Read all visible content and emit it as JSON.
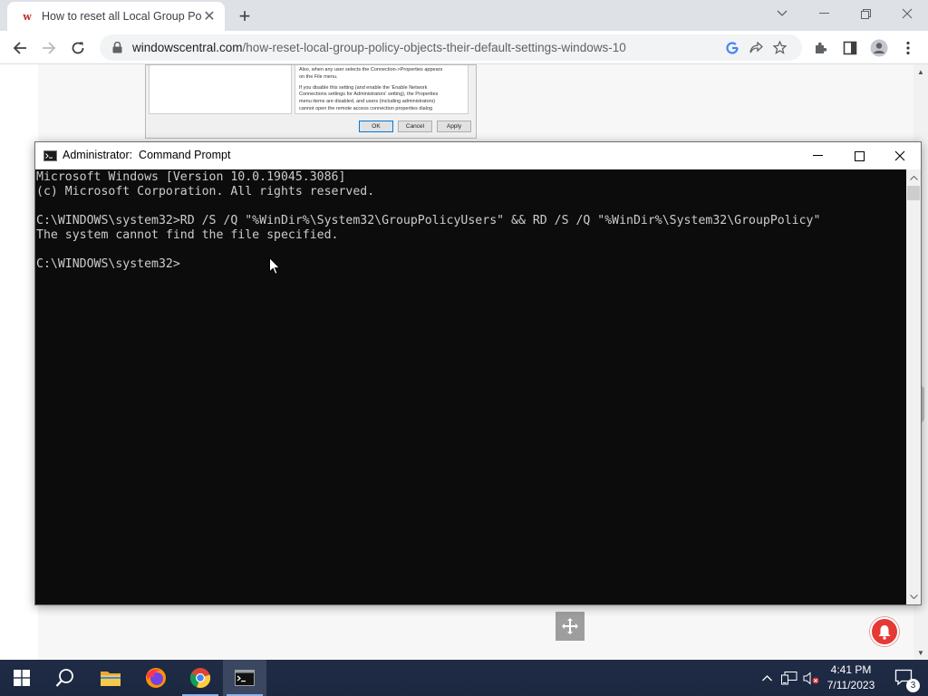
{
  "browser": {
    "tab": {
      "title": "How to reset all Local Group Poli",
      "favicon": "windows-central-favicon"
    },
    "url": {
      "domain": "windowscentral.com",
      "path": "/how-reset-local-group-policy-objects-their-default-settings-windows-10"
    }
  },
  "embedded_screenshot": {
    "text_lines": [
      "Also, when any user selects the Connection->Properties appears",
      "on the File menu.",
      "",
      "If you disable this setting (and enable the 'Enable Network",
      "Connections settings for Administrators' setting), the Properties",
      "menu items are disabled, and users (including administrators)",
      "cannot open the remote access connection properties dialog"
    ],
    "buttons": {
      "ok": "OK",
      "cancel": "Cancel",
      "apply": "Apply"
    }
  },
  "cmd": {
    "title": "Administrator:  Command Prompt",
    "lines": [
      "Microsoft Windows [Version 10.0.19045.3086]",
      "(c) Microsoft Corporation. All rights reserved.",
      "",
      "C:\\WINDOWS\\system32>RD /S /Q \"%WinDir%\\System32\\GroupPolicyUsers\" && RD /S /Q \"%WinDir%\\System32\\GroupPolicy\"",
      "The system cannot find the file specified.",
      "",
      "C:\\WINDOWS\\system32>"
    ]
  },
  "taskbar": {
    "apps": [
      "start-icon",
      "search-icon",
      "file-explorer-icon",
      "firefox-icon",
      "chrome-icon",
      "command-prompt-icon"
    ],
    "clock": {
      "time": "4:41 PM",
      "date": "7/11/2023"
    },
    "notification_count": "3"
  },
  "colors": {
    "console_bg": "#0c0c0c",
    "console_text": "#cccccc",
    "taskbar": "#1f2a44",
    "tab_strip": "#dee1e6"
  }
}
